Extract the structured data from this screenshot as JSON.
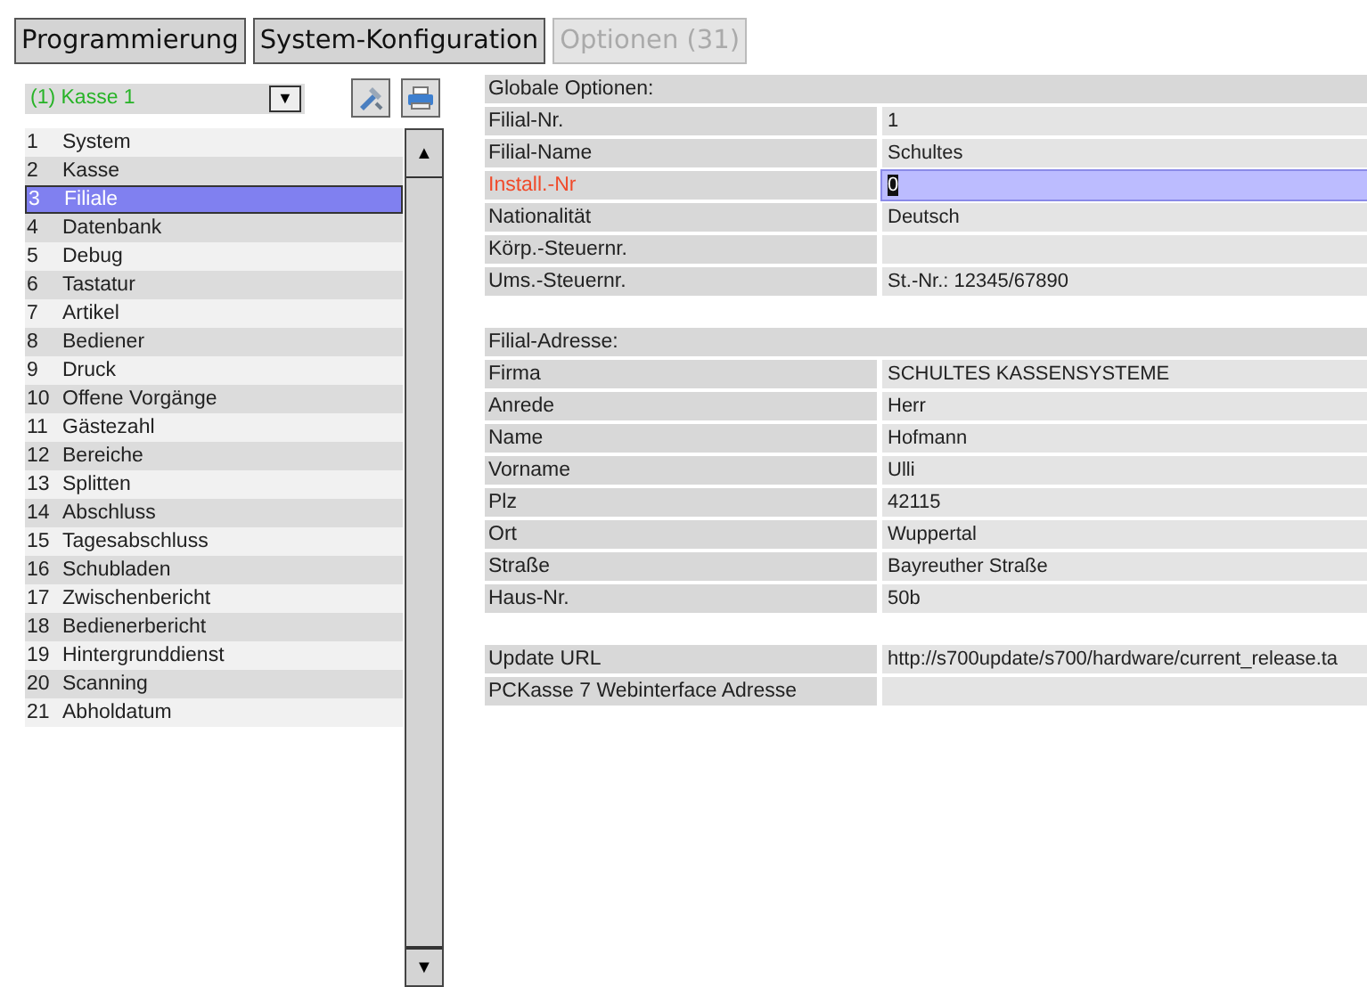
{
  "tabs": [
    {
      "label": "Programmierung",
      "disabled": false
    },
    {
      "label": "System-Konfiguration",
      "disabled": false
    },
    {
      "label": "Optionen (31)",
      "disabled": true
    }
  ],
  "device_select": {
    "value": "(1) Kasse 1",
    "arrow": "▼"
  },
  "categories": [
    {
      "number": "1",
      "label": "System",
      "selected": false
    },
    {
      "number": "2",
      "label": "Kasse",
      "selected": false
    },
    {
      "number": "3",
      "label": "Filiale",
      "selected": true
    },
    {
      "number": "4",
      "label": "Datenbank",
      "selected": false
    },
    {
      "number": "5",
      "label": "Debug",
      "selected": false
    },
    {
      "number": "6",
      "label": "Tastatur",
      "selected": false
    },
    {
      "number": "7",
      "label": "Artikel",
      "selected": false
    },
    {
      "number": "8",
      "label": "Bediener",
      "selected": false
    },
    {
      "number": "9",
      "label": "Druck",
      "selected": false
    },
    {
      "number": "10",
      "label": "Offene Vorgänge",
      "selected": false
    },
    {
      "number": "11",
      "label": "Gästezahl",
      "selected": false
    },
    {
      "number": "12",
      "label": "Bereiche",
      "selected": false
    },
    {
      "number": "13",
      "label": "Splitten",
      "selected": false
    },
    {
      "number": "14",
      "label": "Abschluss",
      "selected": false
    },
    {
      "number": "15",
      "label": "Tagesabschluss",
      "selected": false
    },
    {
      "number": "16",
      "label": "Schubladen",
      "selected": false
    },
    {
      "number": "17",
      "label": "Zwischenbericht",
      "selected": false
    },
    {
      "number": "18",
      "label": "Bedienerbericht",
      "selected": false
    },
    {
      "number": "19",
      "label": "Hintergrunddienst",
      "selected": false
    },
    {
      "number": "20",
      "label": "Scanning",
      "selected": false
    },
    {
      "number": "21",
      "label": "Abholdatum",
      "selected": false
    }
  ],
  "scrollbar": {
    "up": "▲",
    "down": "▼"
  },
  "sections": [
    {
      "title": "Globale Optionen:",
      "rows": [
        {
          "label": "Filial-Nr.",
          "value": "1",
          "selected": false
        },
        {
          "label": "Filial-Name",
          "value": "Schultes",
          "selected": false
        },
        {
          "label": "Install.-Nr",
          "value": "0",
          "selected": true
        },
        {
          "label": "Nationalität",
          "value": "Deutsch",
          "selected": false
        },
        {
          "label": "Körp.-Steuernr.",
          "selected": false
        },
        {
          "label": "Ums.-Steuernr.",
          "value": "St.-Nr.: 12345/67890",
          "selected": false
        }
      ]
    },
    {
      "title": "Filial-Adresse:",
      "rows": [
        {
          "label": "Firma",
          "value": "SCHULTES KASSENSYSTEME",
          "selected": false
        },
        {
          "label": "Anrede",
          "value": "Herr",
          "selected": false
        },
        {
          "label": "Name",
          "value": "Hofmann",
          "selected": false
        },
        {
          "label": "Vorname",
          "value": "Ulli",
          "selected": false
        },
        {
          "label": "Plz",
          "value": "42115",
          "selected": false
        },
        {
          "label": "Ort",
          "value": "Wuppertal",
          "selected": false
        },
        {
          "label": "Straße",
          "value": "Bayreuther Straße",
          "selected": false
        },
        {
          "label": "Haus-Nr.",
          "value": "50b",
          "selected": false
        }
      ]
    },
    {
      "rows": [
        {
          "label": "Update URL",
          "value": "http://s700update/s700/hardware/current_release.ta",
          "selected": false
        },
        {
          "label": "PCKasse 7 Webinterface Adresse",
          "selected": false
        }
      ]
    }
  ]
}
